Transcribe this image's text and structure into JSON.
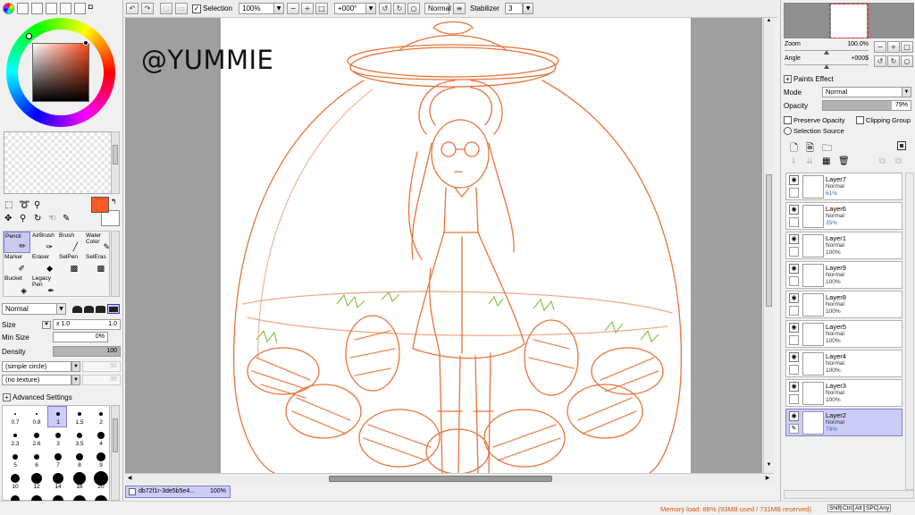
{
  "toolbar": {
    "selection_label": "Selection",
    "zoom": "100%",
    "angle": "+000°",
    "blend_mode": "Normal",
    "stabilizer_label": "Stabilizer",
    "stabilizer_value": "3"
  },
  "tools": {
    "pencil": "Pencil",
    "airbrush": "AirBrush",
    "brush": "Brush",
    "watercolor_1": "Water",
    "watercolor_2": "Color",
    "marker": "Marker",
    "eraser": "Eraser",
    "selpen": "SelPen",
    "seleras": "SelEras",
    "bucket": "Bucket",
    "legacy_pen_1": "Legacy",
    "legacy_pen_2": "Pen"
  },
  "brush_settings": {
    "mode": "Normal",
    "size_label": "Size",
    "size_mult": "x 1.0",
    "size_value": "1.0",
    "min_size_label": "Min Size",
    "min_size_value": "0%",
    "density_label": "Density",
    "density_value": "100",
    "shape": "(simple circle)",
    "shape_value": "50",
    "texture": "(no texture)",
    "texture_value": "95",
    "advanced_label": "Advanced Settings",
    "sizes_row1": [
      "0.7",
      "0.8",
      "1",
      "1.5",
      "2"
    ],
    "sizes_row2": [
      "2.3",
      "2.6",
      "3",
      "3.5",
      "4"
    ],
    "sizes_row3": [
      "5",
      "6",
      "7",
      "8",
      "9"
    ],
    "sizes_row4": [
      "10",
      "12",
      "14",
      "16",
      "20"
    ]
  },
  "canvas": {
    "watermark": "@YUMMIE",
    "doc_tab_name": "db72f1r-3de5b5e4...",
    "doc_tab_zoom": "100%"
  },
  "navigator": {
    "zoom_label": "Zoom",
    "zoom_value": "100.0%",
    "angle_label": "Angle",
    "angle_value": "+000$"
  },
  "layer_props": {
    "paints_effect_label": "Paints Effect",
    "mode_label": "Mode",
    "mode_value": "Normal",
    "opacity_label": "Opacity",
    "opacity_value": "79%",
    "opacity_fraction": 0.79,
    "preserve_opacity_label": "Preserve Opacity",
    "clipping_group_label": "Clipping Group",
    "selection_source_label": "Selection Source"
  },
  "layers": [
    {
      "name": "Layer7",
      "mode": "Normal",
      "opacity": "61%"
    },
    {
      "name": "Layer6",
      "mode": "Normal",
      "opacity": "35%"
    },
    {
      "name": "Layer1",
      "mode": "Normal",
      "opacity": "100%"
    },
    {
      "name": "Layer9",
      "mode": "Normal",
      "opacity": "100%"
    },
    {
      "name": "Layer8",
      "mode": "Normal",
      "opacity": "100%"
    },
    {
      "name": "Layer5",
      "mode": "Normal",
      "opacity": "100%"
    },
    {
      "name": "Layer4",
      "mode": "Normal",
      "opacity": "100%"
    },
    {
      "name": "Layer3",
      "mode": "Normal",
      "opacity": "100%"
    },
    {
      "name": "Layer2",
      "mode": "Normal",
      "opacity": "79%"
    }
  ],
  "status": {
    "memory": "Memory load: 88% (93MB used / 731MB reserved)",
    "keys": [
      "Shift",
      "Ctrl",
      "Alt",
      "SPC",
      "Any"
    ]
  },
  "colors": {
    "primary": "#ff5a22",
    "secondary": "#ffffff",
    "lineart": "#e8733a",
    "leaf": "#8bc34a",
    "selection_highlight": "#ccccf7"
  }
}
